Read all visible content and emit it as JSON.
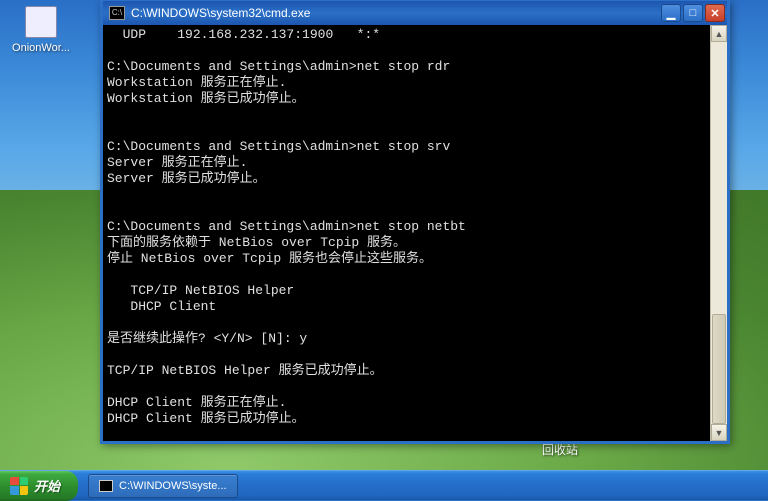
{
  "desktop_icons": [
    {
      "label": "OnionWor..."
    }
  ],
  "recycle_label": "回收站",
  "taskbar": {
    "start_label": "开始",
    "task_item_label": "C:\\WINDOWS\\syste..."
  },
  "cmd": {
    "title_prefix": "C:\\",
    "title": "C:\\WINDOWS\\system32\\cmd.exe",
    "lines": [
      "  UDP    192.168.232.137:1900   *:*",
      "",
      "C:\\Documents and Settings\\admin>net stop rdr",
      "Workstation 服务正在停止.",
      "Workstation 服务已成功停止。",
      "",
      "",
      "C:\\Documents and Settings\\admin>net stop srv",
      "Server 服务正在停止.",
      "Server 服务已成功停止。",
      "",
      "",
      "C:\\Documents and Settings\\admin>net stop netbt",
      "下面的服务依赖于 NetBios over Tcpip 服务。",
      "停止 NetBios over Tcpip 服务也会停止这些服务。",
      "",
      "   TCP/IP NetBIOS Helper",
      "   DHCP Client",
      "",
      "是否继续此操作? <Y/N> [N]: y",
      "",
      "TCP/IP NetBIOS Helper 服务已成功停止。",
      "",
      "DHCP Client 服务正在停止.",
      "DHCP Client 服务已成功停止。"
    ]
  }
}
